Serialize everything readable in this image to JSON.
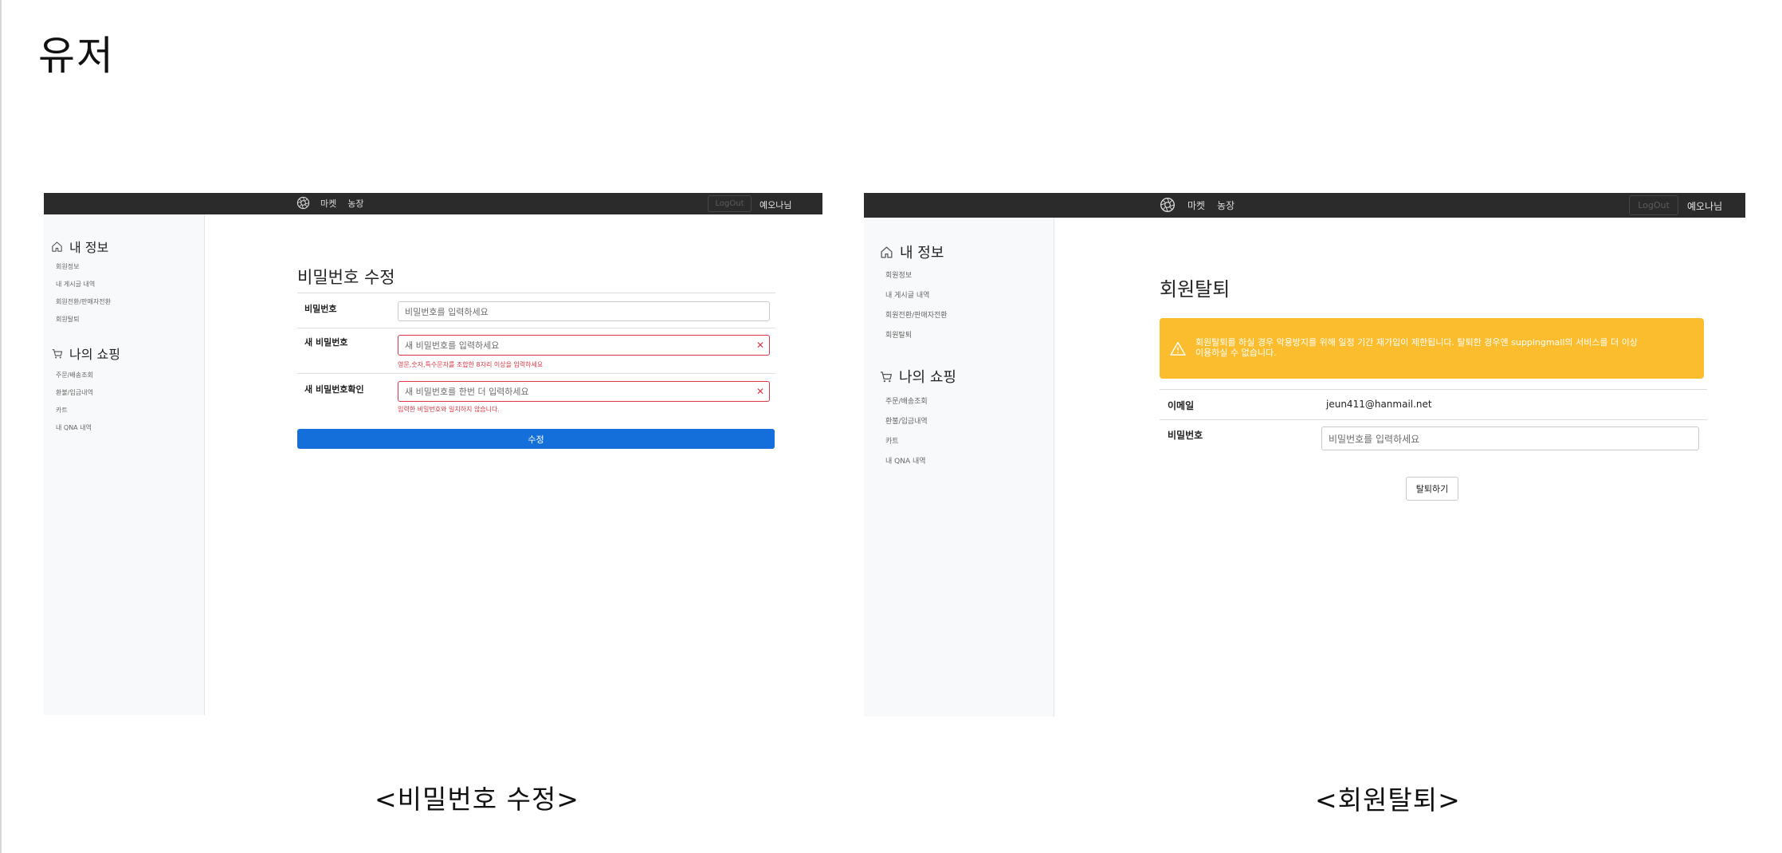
{
  "page_title": "유저",
  "shots": {
    "password": {
      "nav": {
        "market": "마켓",
        "farm": "농장",
        "logout": "LogOut",
        "user": "예오나님"
      },
      "sidebar": {
        "my_info": "내 정보",
        "info_items": [
          "회원정보",
          "내 게시글 내역",
          "회원전환/판매자전환",
          "회원탈퇴"
        ],
        "my_shopping": "나의 쇼핑",
        "shop_items": [
          "주문/배송조회",
          "환불/입금내역",
          "카트",
          "내 QNA 내역"
        ]
      },
      "form": {
        "title": "비밀번호 수정",
        "password_label": "비밀번호",
        "password_placeholder": "비밀번호를 입력하세요",
        "new_password_label": "새 비밀번호",
        "new_password_placeholder": "새 비밀번호를 입력하세요",
        "new_password_error": "영문,숫자,특수문자를 조합한 8자리 이상을 입력하세요",
        "confirm_label": "새 비밀번호확인",
        "confirm_placeholder": "새 비밀번호를 한번 더 입력하세요",
        "confirm_error": "입력한 비밀번호와 일치하지 않습니다.",
        "submit": "수정"
      }
    },
    "withdraw": {
      "nav": {
        "market": "마켓",
        "farm": "농장",
        "logout": "LogOut",
        "user": "예오나님"
      },
      "sidebar": {
        "my_info": "내 정보",
        "info_items": [
          "회원정보",
          "내 게시글 내역",
          "회원전환/판매자전환",
          "회원탈퇴"
        ],
        "my_shopping": "나의 쇼핑",
        "shop_items": [
          "주문/배송조회",
          "환불/입금내역",
          "카트",
          "내 QNA 내역"
        ]
      },
      "form": {
        "title": "회원탈퇴",
        "alert_line1": "회원탈퇴를 하실 경우 악용방지를 위해 일정 기간 재가입이 제한됩니다. 탈퇴한 경우엔 suppingmall의 서비스를 더 이상",
        "alert_line2": "이용하실 수 없습니다.",
        "email_label": "이메일",
        "email_value": "jeun411@hanmail.net",
        "password_label": "비밀번호",
        "password_placeholder": "비밀번호를 입력하세요",
        "submit": "탈퇴하기"
      }
    }
  },
  "captions": {
    "left": "<비밀번호 수정>",
    "right": "<회원탈퇴>"
  },
  "colors": {
    "navbar": "#2b2b2b",
    "sidebar": "#f8f9fa",
    "primary": "#146fdb",
    "danger": "#dc3545",
    "warning": "#fbbd2e"
  },
  "icons": [
    "logo-icon",
    "home-icon",
    "cart-icon",
    "close-icon",
    "warning-icon"
  ]
}
